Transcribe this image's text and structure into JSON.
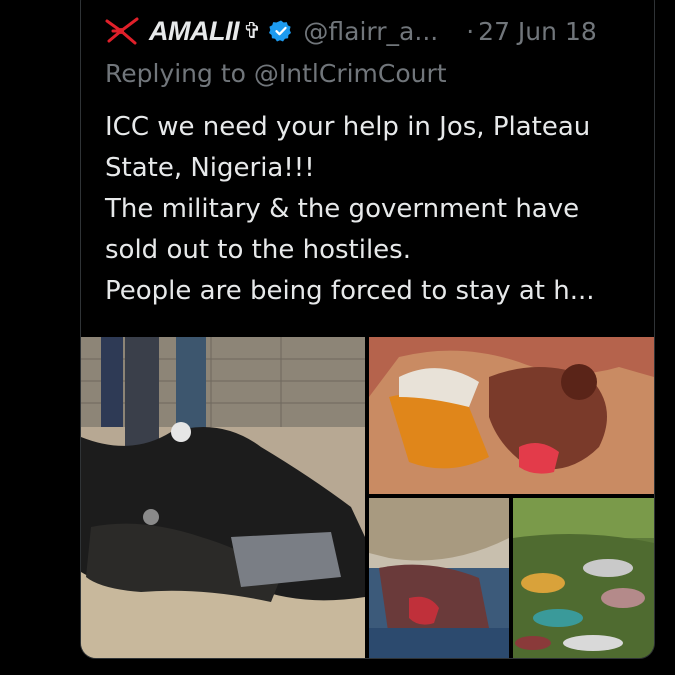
{
  "tweet": {
    "author_name": "AMALII",
    "author_symbol": "✞",
    "handle": "@flairr_a...",
    "separator": "·",
    "date": "27 Jun 18",
    "replying_prefix": "Replying to",
    "replying_to": "@IntlCrimCourt",
    "text_lines": [
      "ICC we need your help in Jos, Plateau",
      "State, Nigeria!!!",
      "The military & the government have",
      "sold out to the hostiles.",
      "People are being forced to stay at h..."
    ]
  },
  "icons": {
    "logo": "red-emblem-icon",
    "verified": "verified-badge-icon"
  },
  "colors": {
    "background": "#000000",
    "text": "#e7e9ea",
    "muted": "#71767b",
    "verified_blue": "#1d9bf0",
    "logo_red": "#e0202a"
  },
  "media": [
    {
      "name": "photo-left"
    },
    {
      "name": "photo-top-right"
    },
    {
      "name": "photo-bottom-middle"
    },
    {
      "name": "photo-bottom-right"
    }
  ]
}
